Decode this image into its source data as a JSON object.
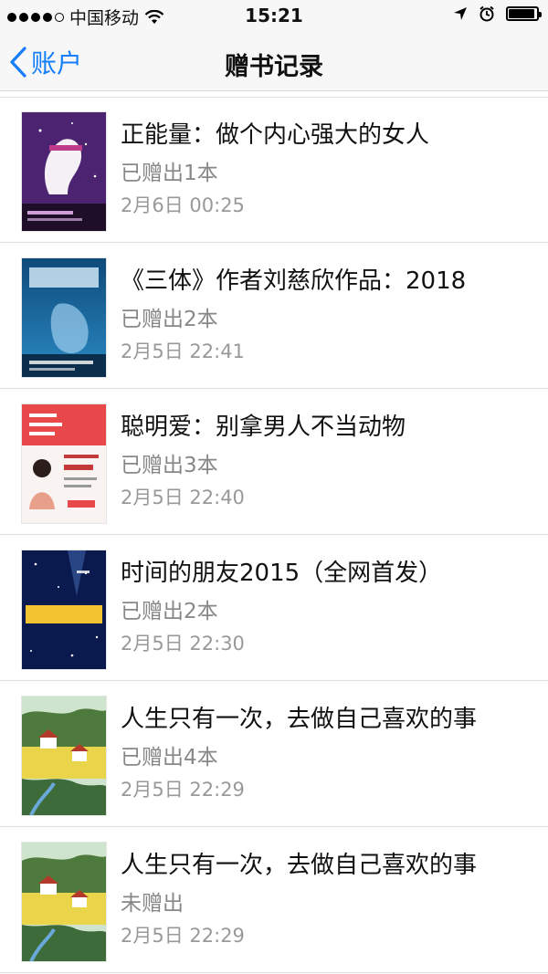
{
  "status_bar": {
    "carrier": "中国移动",
    "time": "15:21"
  },
  "nav": {
    "back_label": "账户",
    "title": "赠书记录"
  },
  "records": [
    {
      "title": "正能量：做个内心强大的女人",
      "status": "已赠出1本",
      "time": "2月6日 00:25"
    },
    {
      "title": "《三体》作者刘慈欣作品：2018",
      "status": "已赠出2本",
      "time": "2月5日 22:41"
    },
    {
      "title": "聪明爱：别拿男人不当动物",
      "status": "已赠出3本",
      "time": "2月5日 22:40"
    },
    {
      "title": "时间的朋友2015（全网首发）",
      "status": "已赠出2本",
      "time": "2月5日 22:30"
    },
    {
      "title": "人生只有一次，去做自己喜欢的事",
      "status": "已赠出4本",
      "time": "2月5日 22:29"
    },
    {
      "title": "人生只有一次，去做自己喜欢的事",
      "status": "未赠出",
      "time": "2月5日 22:29"
    }
  ]
}
